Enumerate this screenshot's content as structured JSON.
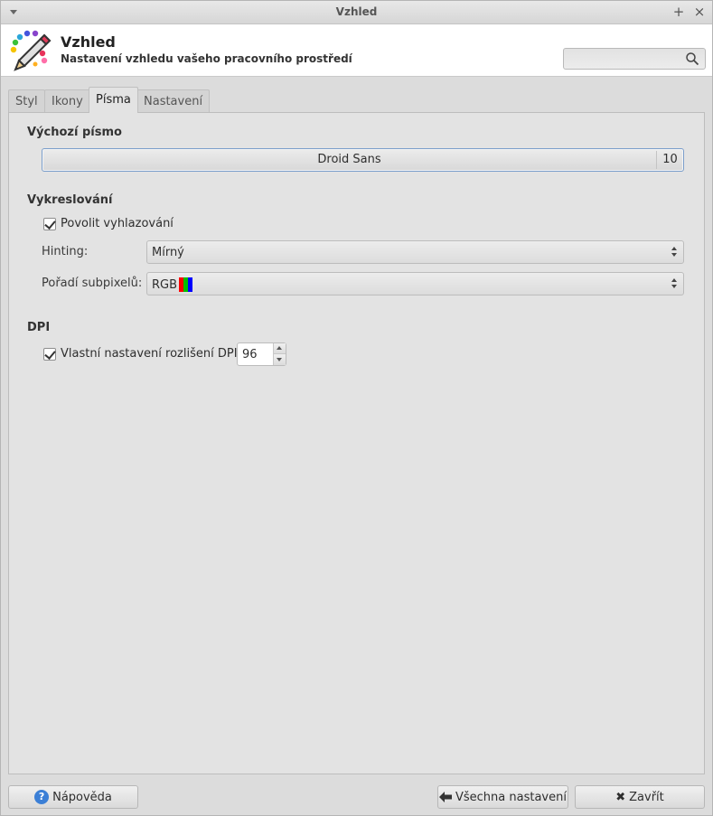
{
  "window": {
    "title": "Vzhled"
  },
  "header": {
    "title": "Vzhled",
    "subtitle": "Nastavení vzhledu vašeho pracovního prostředí",
    "search_placeholder": ""
  },
  "tabs": [
    {
      "label": "Styl",
      "active": false
    },
    {
      "label": "Ikony",
      "active": false
    },
    {
      "label": "Písma",
      "active": true
    },
    {
      "label": "Nastavení",
      "active": false
    }
  ],
  "default_font": {
    "heading": "Výchozí písmo",
    "name": "Droid Sans",
    "size": "10"
  },
  "rendering": {
    "heading": "Vykreslování",
    "antialias_label": "Povolit vyhlazování",
    "antialias_checked": true,
    "hinting_label": "Hinting:",
    "hinting_value": "Mírný",
    "subpixel_label": "Pořadí subpixelů:",
    "subpixel_value": "RGB",
    "subpixel_colors": [
      "#ff0000",
      "#00c000",
      "#0000ff"
    ]
  },
  "dpi": {
    "heading": "DPI",
    "custom_label": "Vlastní nastavení rozlišení DPI:",
    "custom_checked": true,
    "value": "96"
  },
  "footer": {
    "help_label": "Nápověda",
    "all_settings_label": "Všechna nastavení",
    "close_label": "Zavřít"
  }
}
